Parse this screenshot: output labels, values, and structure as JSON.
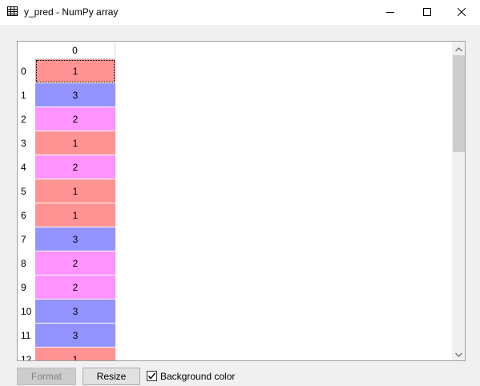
{
  "window": {
    "title": "y_pred - NumPy array",
    "icon": "table-icon",
    "controls": [
      "minimize-icon",
      "maximize-icon",
      "close-icon"
    ]
  },
  "table": {
    "column_header": "0",
    "rows": [
      {
        "index": "0",
        "value": "1",
        "color": "#ff9393"
      },
      {
        "index": "1",
        "value": "3",
        "color": "#9393ff"
      },
      {
        "index": "2",
        "value": "2",
        "color": "#ff93ff"
      },
      {
        "index": "3",
        "value": "1",
        "color": "#ff9393"
      },
      {
        "index": "4",
        "value": "2",
        "color": "#ff93ff"
      },
      {
        "index": "5",
        "value": "1",
        "color": "#ff9393"
      },
      {
        "index": "6",
        "value": "1",
        "color": "#ff9393"
      },
      {
        "index": "7",
        "value": "3",
        "color": "#9393ff"
      },
      {
        "index": "8",
        "value": "2",
        "color": "#ff93ff"
      },
      {
        "index": "9",
        "value": "2",
        "color": "#ff93ff"
      },
      {
        "index": "10",
        "value": "3",
        "color": "#9393ff"
      },
      {
        "index": "11",
        "value": "3",
        "color": "#9393ff"
      },
      {
        "index": "12",
        "value": "1",
        "color": "#ff9393"
      }
    ],
    "selected_row": 0
  },
  "footer": {
    "format_label": "Format",
    "resize_label": "Resize",
    "background_color_label": "Background color",
    "background_color_checked": true
  }
}
